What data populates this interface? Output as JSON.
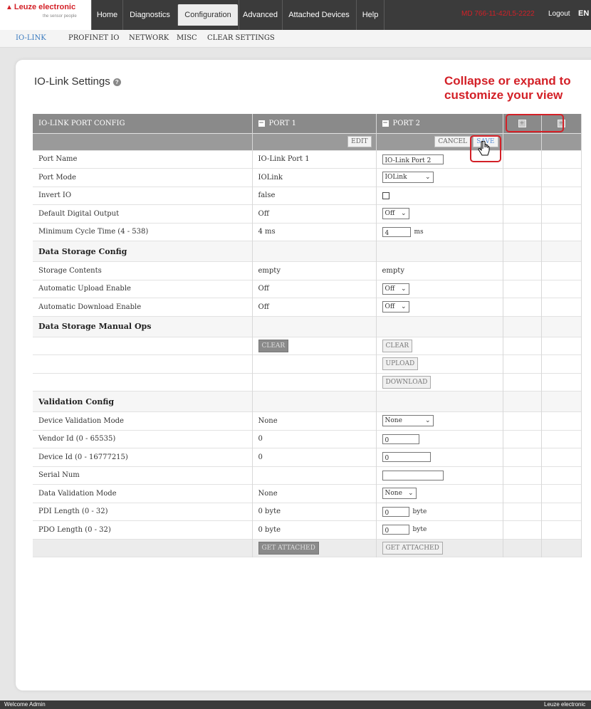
{
  "header": {
    "logo_name": "Leuze electronic",
    "logo_tagline": "the sensor people",
    "nav": [
      "Home",
      "Diagnostics",
      "Configuration",
      "Advanced",
      "Attached Devices",
      "Help"
    ],
    "active_nav": "Configuration",
    "device_id": "MD 766-11-42/L5-2222",
    "logout_label": "Logout",
    "language": "EN",
    "accent": "#d32027"
  },
  "subnav": [
    "IO-LINK",
    "PROFINET IO",
    "NETWORK",
    "MISC",
    "CLEAR SETTINGS"
  ],
  "page": {
    "title": "IO-Link Settings",
    "annotation_line1": "Collapse or expand to",
    "annotation_line2": "customize your view"
  },
  "table": {
    "header": {
      "config": "IO-LINK PORT CONFIG",
      "port1": "PORT 1",
      "port2": "PORT 2"
    },
    "toolbar": {
      "edit": "EDIT",
      "cancel": "CANCEL",
      "save": "SAVE"
    },
    "rows": {
      "port_name": {
        "label": "Port Name",
        "p1": "IO-Link Port 1",
        "p2": "IO-Link Port 2"
      },
      "port_mode": {
        "label": "Port Mode",
        "p1": "IOLink",
        "p2": "IOLink"
      },
      "invert_io": {
        "label": "Invert IO",
        "p1": "false"
      },
      "default_output": {
        "label": "Default Digital Output",
        "p1": "Off",
        "p2": "Off"
      },
      "min_cycle": {
        "label": "Minimum Cycle Time (4 - 538)",
        "p1": "4 ms",
        "p2": "4",
        "unit": "ms"
      },
      "ds_config": {
        "label": "Data Storage Config"
      },
      "storage": {
        "label": "Storage Contents",
        "p1": "empty",
        "p2": "empty"
      },
      "auto_upload": {
        "label": "Automatic Upload Enable",
        "p1": "Off",
        "p2": "Off"
      },
      "auto_download": {
        "label": "Automatic Download Enable",
        "p1": "Off",
        "p2": "Off"
      },
      "ds_manual": {
        "label": "Data Storage Manual Ops"
      },
      "clear": {
        "p1": "CLEAR",
        "p2": "CLEAR"
      },
      "upload": {
        "p2": "UPLOAD"
      },
      "download": {
        "p2": "DOWNLOAD"
      },
      "val_config": {
        "label": "Validation Config"
      },
      "dev_val_mode": {
        "label": "Device Validation Mode",
        "p1": "None",
        "p2": "None"
      },
      "vendor_id": {
        "label": "Vendor Id (0 - 65535)",
        "p1": "0",
        "p2": "0"
      },
      "device_id": {
        "label": "Device Id (0 - 16777215)",
        "p1": "0",
        "p2": "0"
      },
      "serial": {
        "label": "Serial Num",
        "p1": "",
        "p2": ""
      },
      "data_val_mode": {
        "label": "Data Validation Mode",
        "p1": "None",
        "p2": "None"
      },
      "pdi": {
        "label": "PDI Length (0 - 32)",
        "p1": "0 byte",
        "p2": "0",
        "unit": "byte"
      },
      "pdo": {
        "label": "PDO Length (0 - 32)",
        "p1": "0 byte",
        "p2": "0",
        "unit": "byte"
      },
      "get_attached": {
        "p1": "GET ATTACHED",
        "p2": "GET ATTACHED"
      }
    }
  },
  "footer": {
    "left": "Welcome Admin",
    "right": "Leuze electronic"
  }
}
